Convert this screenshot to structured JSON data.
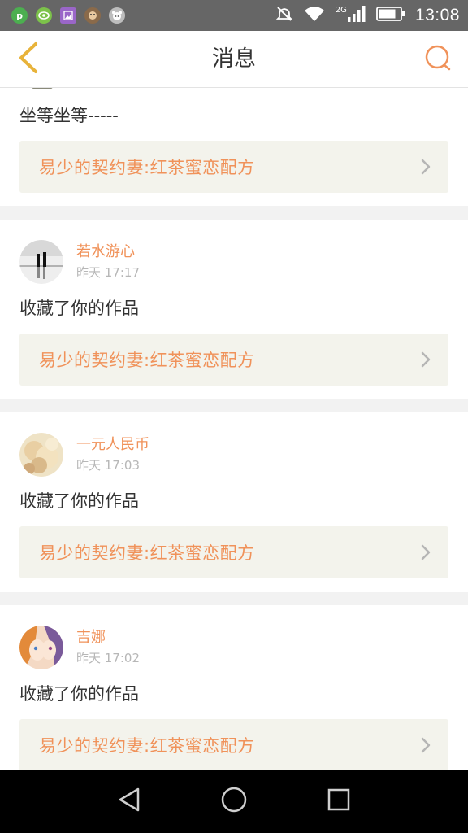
{
  "status_bar": {
    "time": "13:08",
    "network": "2G",
    "icons": [
      "app-p-icon",
      "eye-app-icon",
      "gallery-app-icon",
      "monkey-app-icon",
      "bear-app-icon",
      "silent-icon",
      "wifi-icon",
      "signal-icon",
      "battery-icon"
    ]
  },
  "header": {
    "title": "消息",
    "back_icon": "chevron-left-icon",
    "search_icon": "search-icon"
  },
  "colors": {
    "accent": "#f0925a",
    "back_arrow": "#e8b33a",
    "link_bg": "#f3f3ec",
    "divider_bg": "#f2f2f2"
  },
  "messages": [
    {
      "text": "坐等坐等-----",
      "link": "易少的契约妻:红茶蜜恋配方"
    },
    {
      "user": "若水游心",
      "time": "昨天 17:17",
      "text": "收藏了你的作品",
      "link": "易少的契约妻:红茶蜜恋配方"
    },
    {
      "user": "一元人民币",
      "time": "昨天 17:03",
      "text": "收藏了你的作品",
      "link": "易少的契约妻:红茶蜜恋配方"
    },
    {
      "user": "吉娜",
      "time": "昨天 17:02",
      "text": "收藏了你的作品",
      "link": "易少的契约妻:红茶蜜恋配方"
    }
  ],
  "nav": {
    "icons": [
      "back-triangle-icon",
      "home-circle-icon",
      "recents-square-icon"
    ]
  }
}
